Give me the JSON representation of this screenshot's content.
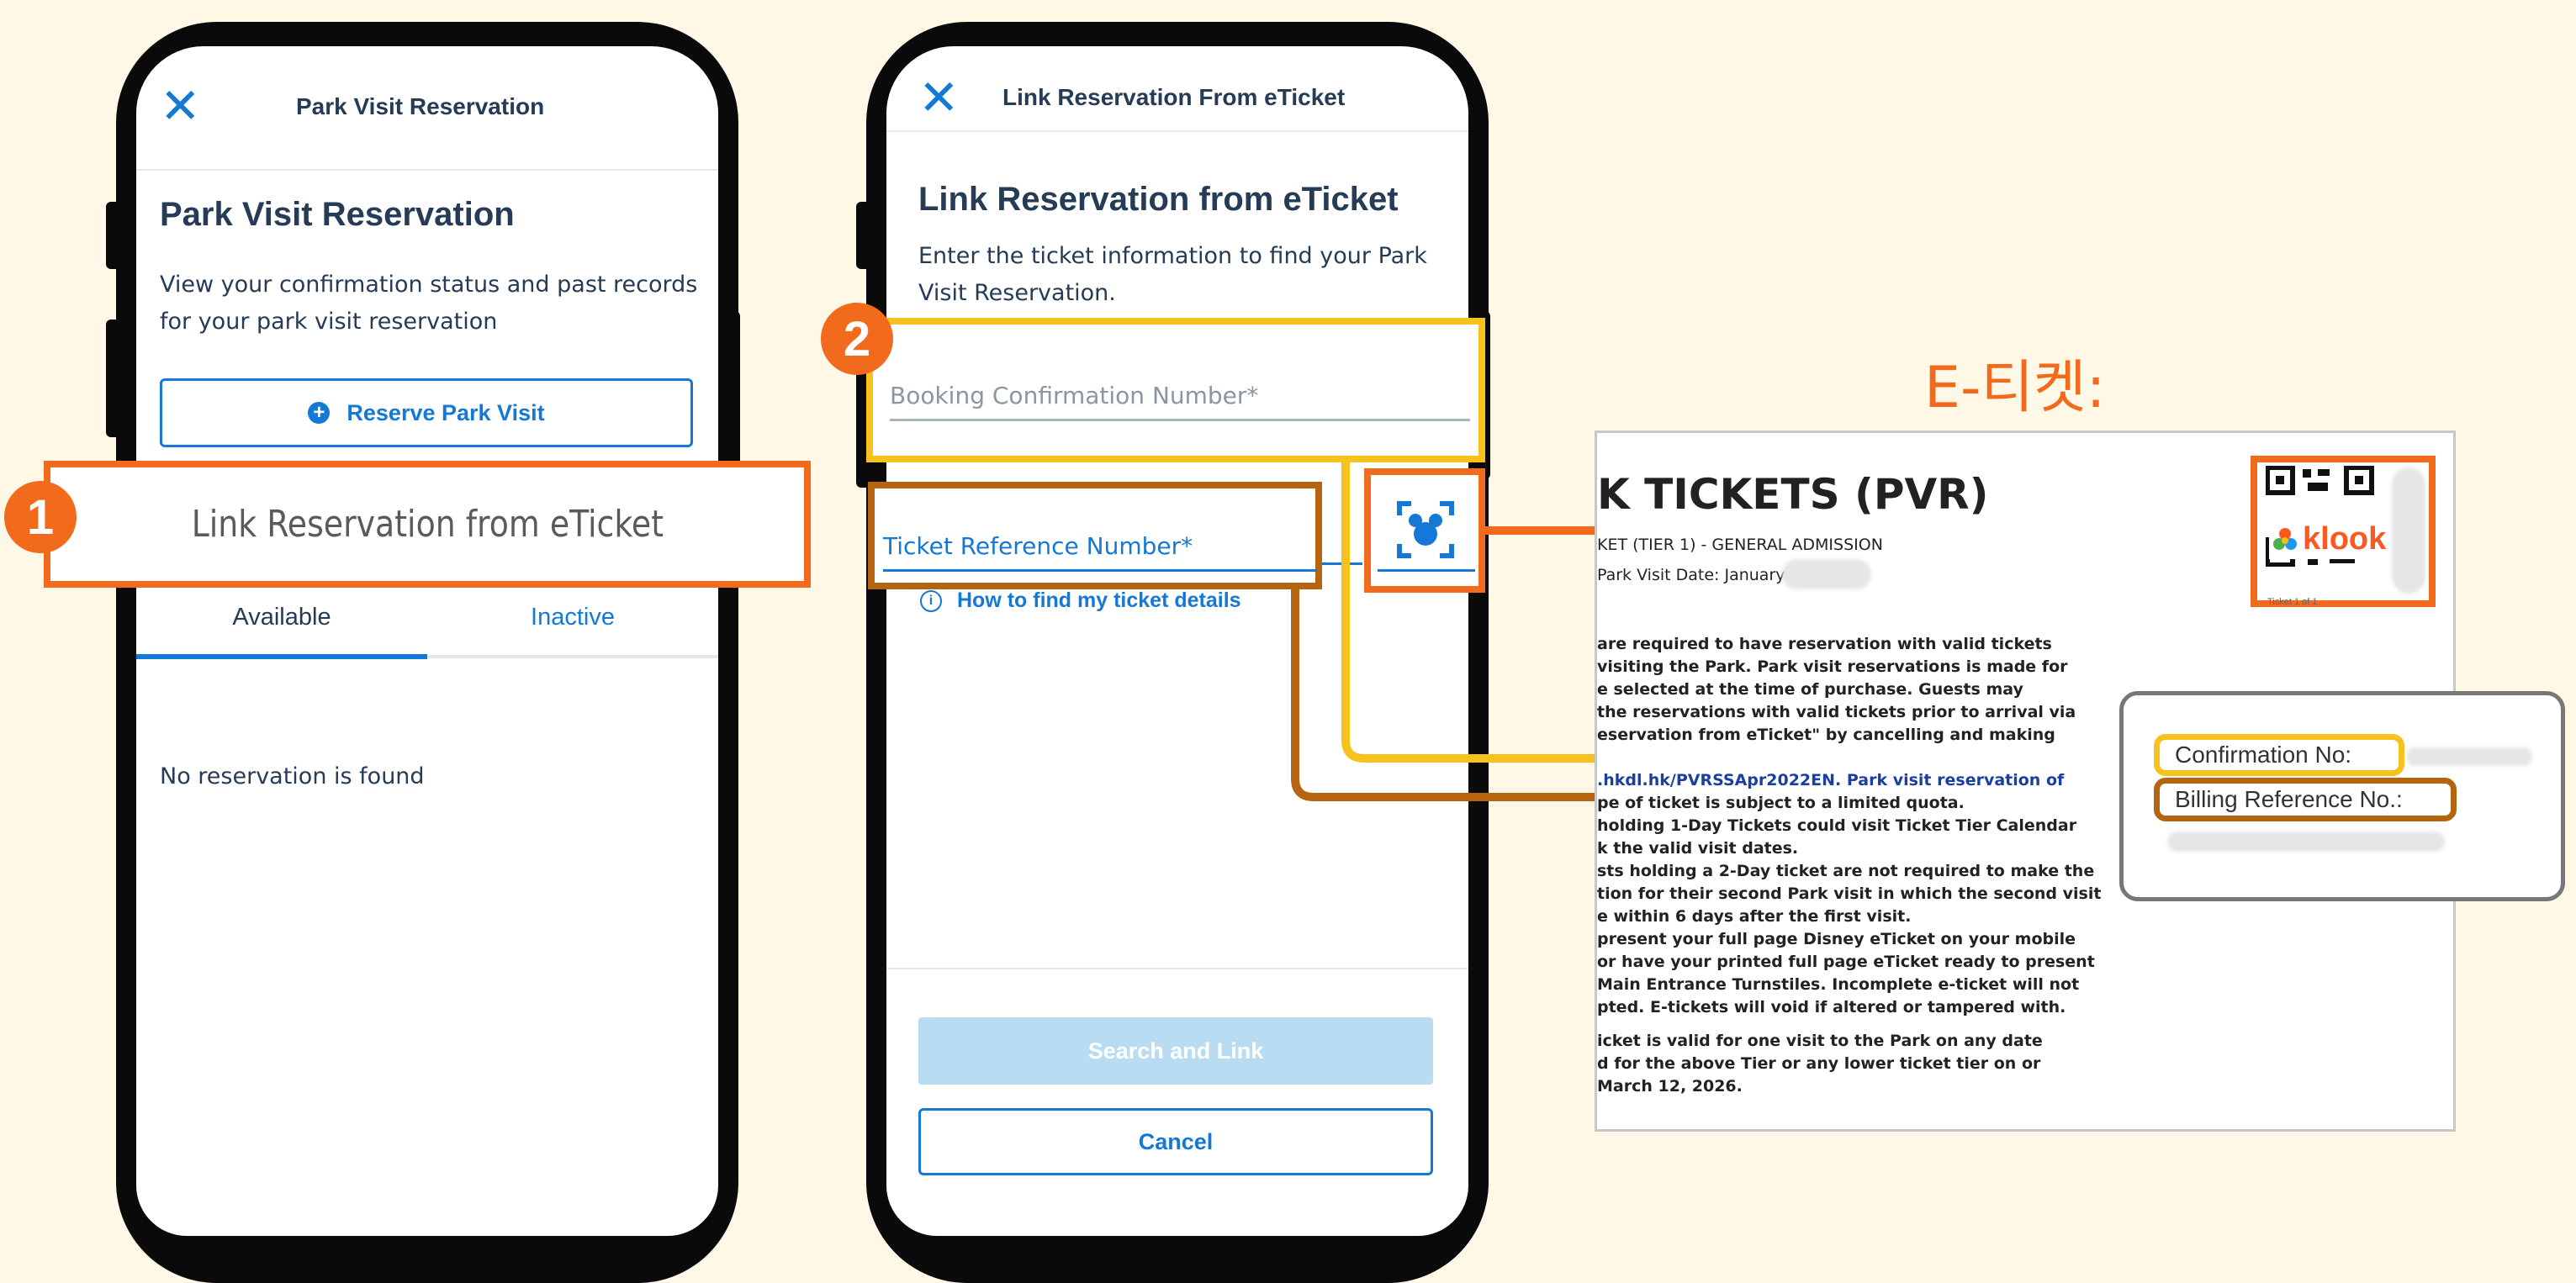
{
  "phone1": {
    "header_title": "Park Visit Reservation",
    "page_title": "Park Visit Reservation",
    "description": "View your confirmation status and past records for your park visit reservation",
    "reserve_button": "Reserve Park Visit",
    "link_option": "Link Reservation from eTicket",
    "tabs": [
      {
        "label": "Available",
        "active": true
      },
      {
        "label": "Inactive",
        "active": false
      }
    ],
    "empty_message": "No reservation is found"
  },
  "phone2": {
    "header_title": "Link Reservation From eTicket",
    "page_title": "Link Reservation from eTicket",
    "description": "Enter the ticket information to find your Park Visit Reservation.",
    "booking_field_placeholder": "Booking Confirmation Number*",
    "ticket_ref_placeholder": "Ticket Reference Number*",
    "help_link": "How to find my ticket details",
    "search_button": "Search and Link",
    "cancel_button": "Cancel"
  },
  "badges": {
    "step1": "1",
    "step2": "2"
  },
  "eticket": {
    "heading": "E-티켓:",
    "title": "K TICKETS (PVR)",
    "subtitle": "KET (TIER 1) - GENERAL ADMISSION",
    "visit_date_label": "Park Visit Date:  January",
    "qr_caption": "Ticket 1 of 1",
    "klook_label": "klook",
    "body_lines": [
      "are required to have reservation with valid tickets",
      "visiting the Park. Park visit reservations is made for",
      "e selected at the time of purchase. Guests may",
      "the reservations with valid tickets prior to arrival via",
      "eservation from eTicket\" by cancelling and making",
      "",
      ".hkdl.hk/PVRSSApr2022EN. Park visit reservation of",
      "pe of ticket is subject to a limited quota.",
      "holding 1-Day Tickets could visit Ticket Tier Calendar",
      "k the valid visit dates.",
      "sts holding a 2-Day ticket are not required to make the",
      "tion for their second Park visit in which the second visit",
      "e within 6 days after the first visit.",
      "present your full page Disney eTicket on your mobile",
      "or have your printed full page eTicket ready to present",
      "Main Entrance Turnstiles. Incomplete e-ticket will not",
      "pted. E-tickets will void if altered or tampered with.",
      "",
      "icket is valid for one visit to the Park on any date",
      "d for the above Tier or any lower ticket tier on or",
      "March 12, 2026."
    ],
    "confirmation_label": "Confirmation No:",
    "billing_label": "Billing Reference No.:"
  },
  "colors": {
    "background": "#fff8e6",
    "accent_blue": "#1479d6",
    "callout_orange": "#f26a1b",
    "callout_yellow": "#f7c11e",
    "callout_brown": "#b5650f",
    "navy_text": "#253b56",
    "disabled_button": "#b9dcf3"
  }
}
